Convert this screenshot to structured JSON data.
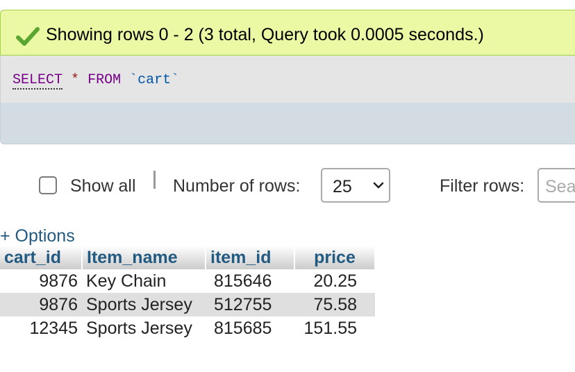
{
  "message": {
    "text": "Showing rows 0 - 2 (3 total, Query took 0.0005 seconds.)",
    "icon": "check-icon",
    "background": "#ebf8a4"
  },
  "sql": {
    "select": "SELECT",
    "star": "*",
    "from": "FROM",
    "table": "`cart`"
  },
  "navigation": {
    "show_all_label": "Show all",
    "show_all_checked": false,
    "rows_label": "Number of rows:",
    "rows_value": "25",
    "filter_label": "Filter rows:",
    "filter_placeholder": "Search this table"
  },
  "options_label": "+ Options",
  "table": {
    "columns": [
      "cart_id",
      "Item_name",
      "item_id",
      "price"
    ],
    "rows": [
      [
        "9876",
        "Key Chain",
        "815646",
        "20.25"
      ],
      [
        "9876",
        "Sports Jersey",
        "512755",
        "75.58"
      ],
      [
        "12345",
        "Sports Jersey",
        "815685",
        "151.55"
      ]
    ]
  }
}
